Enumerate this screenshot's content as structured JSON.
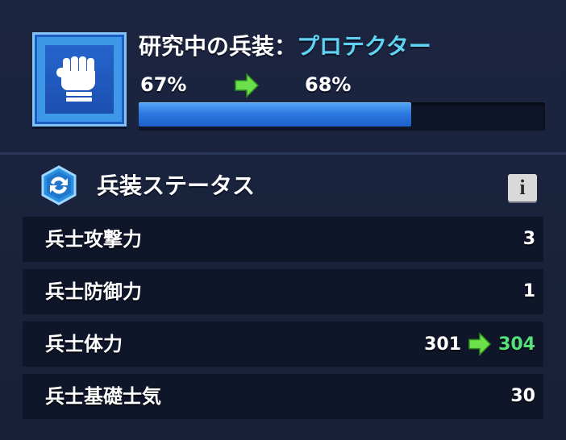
{
  "research": {
    "label": "研究中の兵装：",
    "name": "プロテクター",
    "from_pct_text": "67%",
    "to_pct_text": "68%",
    "progress": 0.67,
    "icon": "gauntlet-icon",
    "arrow_icon": "green-arrow-icon"
  },
  "status": {
    "title": "兵装ステータス",
    "icon": "refresh-badge-icon",
    "info_label": "i",
    "rows": [
      {
        "label": "兵士攻撃力",
        "value": "3"
      },
      {
        "label": "兵士防御力",
        "value": "1"
      },
      {
        "label": "兵士体力",
        "from": "301",
        "to": "304"
      },
      {
        "label": "兵士基礎士気",
        "value": "30"
      }
    ]
  },
  "colors": {
    "background": "#182038",
    "accent_name": "#5fd4f2",
    "progress": "#2c78e0",
    "increase": "#55e07a",
    "row_bg": "#10162a"
  }
}
